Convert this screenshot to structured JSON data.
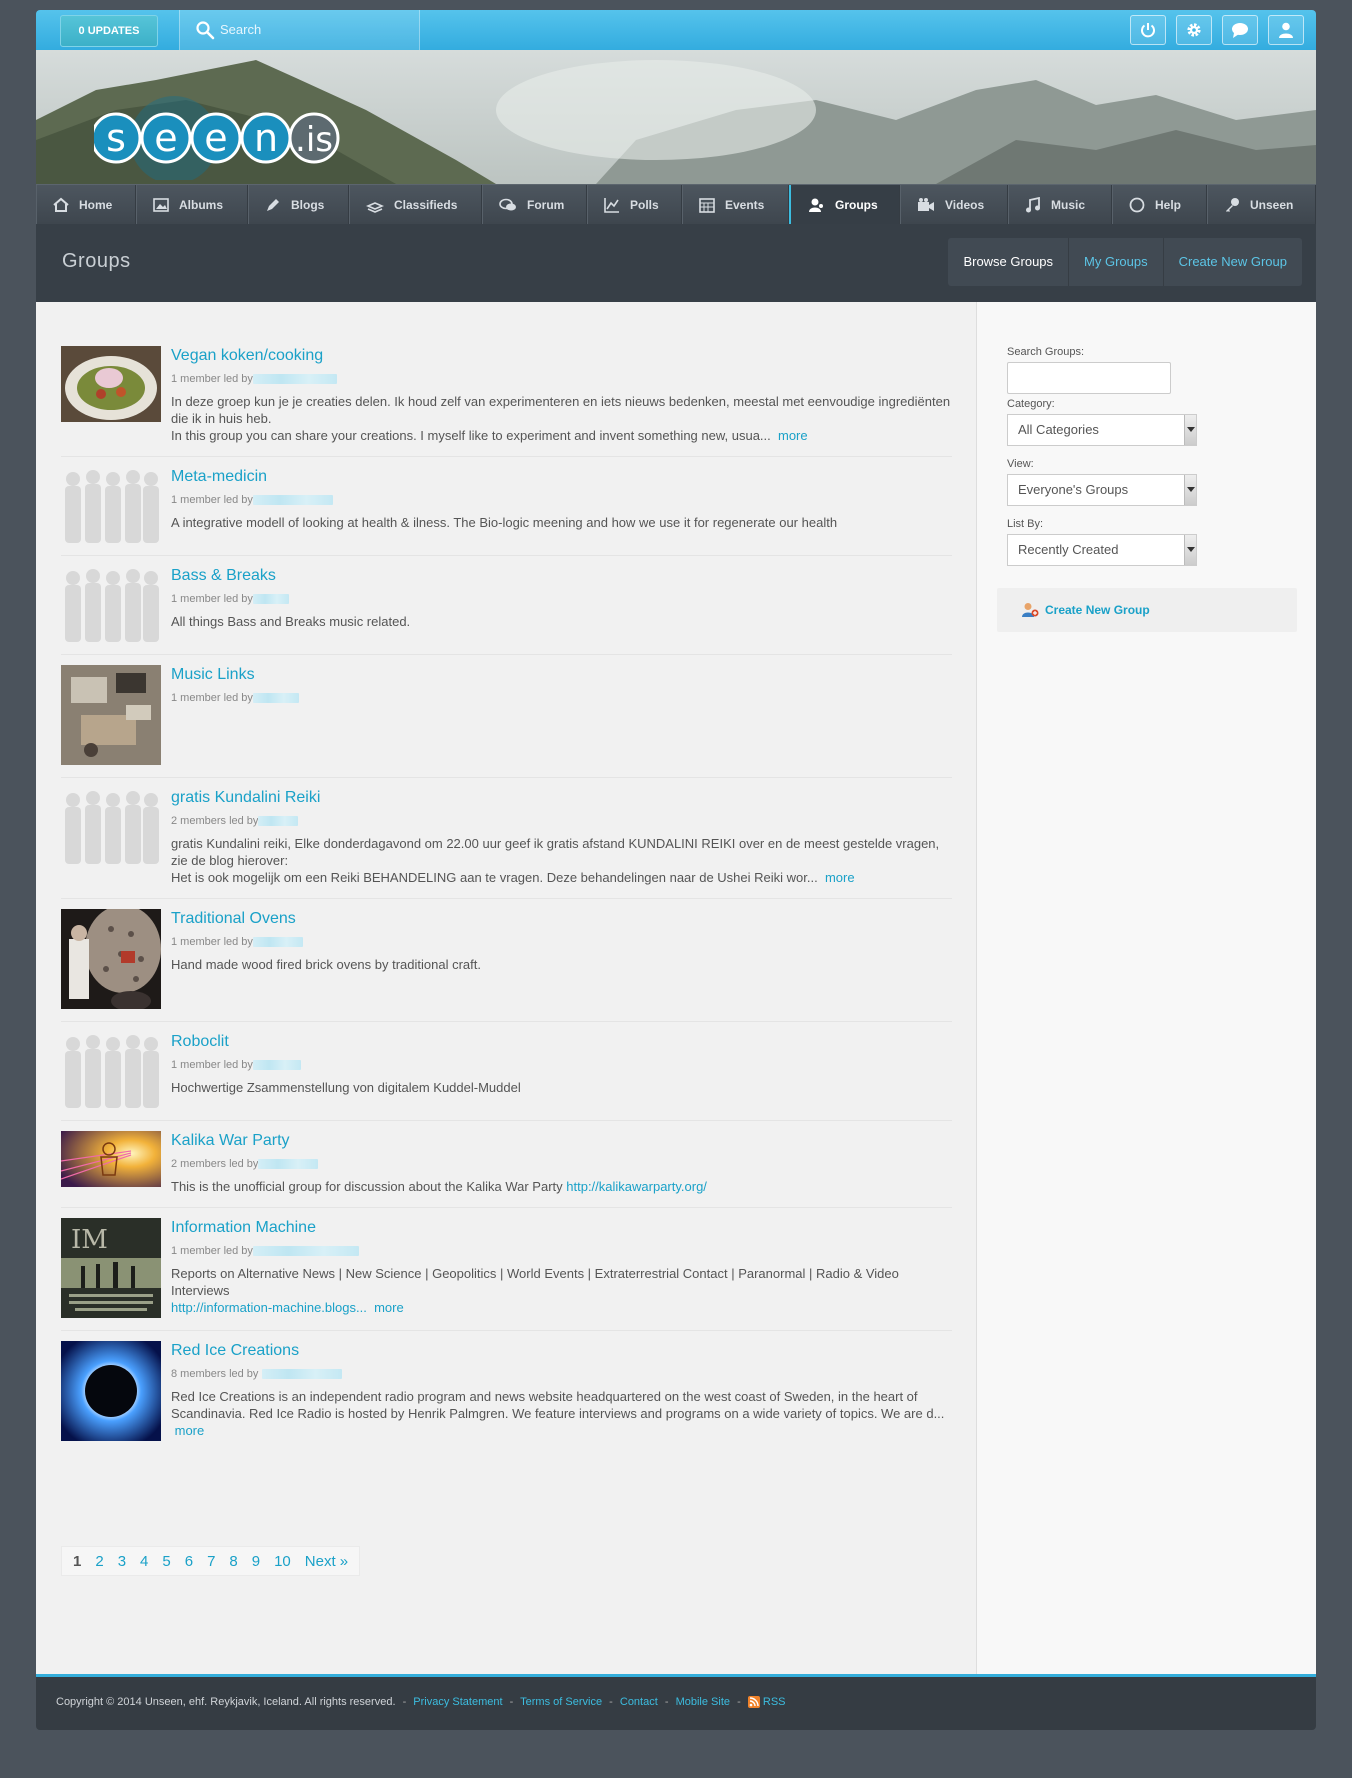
{
  "topbar": {
    "updates_label": "0 UPDATES",
    "search_placeholder": "Search",
    "icons": [
      "power-icon",
      "gear-icon",
      "chat-icon",
      "user-icon"
    ]
  },
  "logo": {
    "text_main": "seen",
    "text_suffix": ".is"
  },
  "nav": [
    {
      "label": "Home",
      "icon": "home-icon"
    },
    {
      "label": "Albums",
      "icon": "image-icon"
    },
    {
      "label": "Blogs",
      "icon": "pen-icon"
    },
    {
      "label": "Classifieds",
      "icon": "stack-icon"
    },
    {
      "label": "Forum",
      "icon": "chat-bubbles-icon"
    },
    {
      "label": "Polls",
      "icon": "line-chart-icon"
    },
    {
      "label": "Events",
      "icon": "calendar-icon"
    },
    {
      "label": "Groups",
      "icon": "users-icon",
      "active": true
    },
    {
      "label": "Videos",
      "icon": "video-camera-icon"
    },
    {
      "label": "Music",
      "icon": "music-icon"
    },
    {
      "label": "Help",
      "icon": "circle-icon"
    },
    {
      "label": "Unseen",
      "icon": "key-icon"
    }
  ],
  "page": {
    "title": "Groups",
    "subnav": [
      "Browse Groups",
      "My Groups",
      "Create New Group"
    ]
  },
  "groups": [
    {
      "title": "Vegan koken/cooking",
      "meta": "1 member led by",
      "desc1": "In deze groep kun je je creaties delen. Ik houd zelf van experimenteren en iets nieuws bedenken, meestal met eenvoudige ingrediënten die ik in huis heb.",
      "desc2": "In this group you can share your creations. I myself like to experiment and invent something new, usua...",
      "more": "more"
    },
    {
      "title": "Meta-medicin",
      "meta": "1 member led by",
      "desc1": "A integrative modell of looking at health & ilness. The Bio-logic meening and how we use it for regenerate our health"
    },
    {
      "title": "Bass & Breaks",
      "meta": "1 member led by",
      "desc1": "All things Bass and Breaks music related."
    },
    {
      "title": "Music Links",
      "meta": "1 member led by"
    },
    {
      "title": "gratis Kundalini Reiki",
      "meta": "2 members led by",
      "desc1": "gratis Kundalini reiki, Elke donderdagavond om 22.00 uur geef ik gratis afstand KUNDALINI REIKI over en de meest gestelde vragen, zie de blog hierover:",
      "desc2": "Het is ook mogelijk om een Reiki BEHANDELING aan te vragen. Deze behandelingen naar de Ushei Reiki wor...",
      "more": "more"
    },
    {
      "title": "Traditional Ovens",
      "meta": "1 member led by",
      "desc1": "Hand made wood fired brick ovens by traditional craft."
    },
    {
      "title": "Roboclit",
      "meta": "1 member led by",
      "desc1": "Hochwertige Zsammenstellung von digitalem Kuddel-Muddel"
    },
    {
      "title": "Kalika War Party",
      "meta": "2 members led by",
      "desc1": "This is the unofficial group for discussion about the Kalika War Party",
      "link": "http://kalikawarparty.org/"
    },
    {
      "title": "Information Machine",
      "meta": "1 member led by",
      "desc1": "Reports on Alternative News | New Science | Geopolitics | World Events | Extraterrestrial Contact | Paranormal | Radio & Video Interviews",
      "link": "http://information-machine.blogs...",
      "more": "more",
      "thumb_text": "IM"
    },
    {
      "title": "Red Ice Creations",
      "meta": "8 members led by",
      "desc1": "Red Ice Creations is an independent radio program and news website headquartered on the west coast of Sweden, in the heart of Scandinavia. Red Ice Radio is hosted by Henrik Palmgren. We feature interviews and programs on a wide variety of topics. We are d...",
      "more": "more"
    }
  ],
  "pager": {
    "pages": [
      "1",
      "2",
      "3",
      "4",
      "5",
      "6",
      "7",
      "8",
      "9",
      "10"
    ],
    "next": "Next »"
  },
  "sidebar": {
    "search_label": "Search Groups:",
    "category_label": "Category:",
    "category_value": "All Categories",
    "view_label": "View:",
    "view_value": "Everyone's Groups",
    "listby_label": "List By:",
    "listby_value": "Recently Created",
    "create_label": "Create New Group"
  },
  "footer": {
    "copyright": "Copyright © 2014 Unseen, ehf. Reykjavik, Iceland. All rights reserved.",
    "links": [
      "Privacy Statement",
      "Terms of Service",
      "Contact",
      "Mobile Site",
      "RSS"
    ]
  },
  "colors": {
    "accent": "#1aa1c8",
    "topbar": "#33acdf",
    "dark": "#373f47"
  }
}
